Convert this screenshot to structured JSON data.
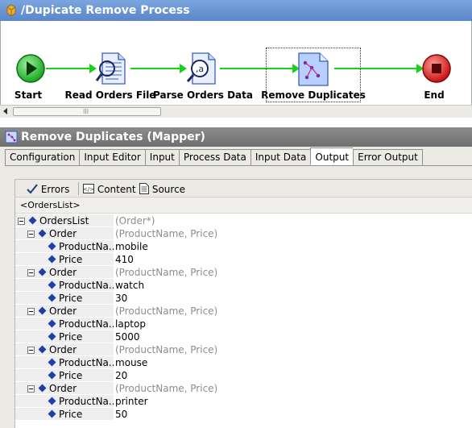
{
  "process": {
    "title": "/Dupicate Remove Process",
    "nodes": [
      {
        "label": "Start"
      },
      {
        "label": "Read Orders File"
      },
      {
        "label": "Parse Orders Data"
      },
      {
        "label": "Remove Duplicates"
      },
      {
        "label": "End"
      }
    ],
    "scroll_grip": "III"
  },
  "mapper": {
    "title": "Remove Duplicates (Mapper)",
    "tabs": [
      "Configuration",
      "Input Editor",
      "Input",
      "Process Data",
      "Input Data",
      "Output",
      "Error Output"
    ],
    "active_tab": "Output",
    "toolbar": {
      "errors": "Errors",
      "content": "Content",
      "source": "Source"
    },
    "root_label": "<OrdersList>",
    "tree": [
      {
        "name": "OrdersList",
        "value": "(Order*)",
        "type": true,
        "level": 0,
        "expander": true
      },
      {
        "name": "Order",
        "value": "(ProductName, Price)",
        "type": true,
        "level": 1,
        "expander": true
      },
      {
        "name": "ProductNa...",
        "value": "mobile",
        "type": false,
        "level": 2,
        "expander": false
      },
      {
        "name": "Price",
        "value": "410",
        "type": false,
        "level": 2,
        "expander": false
      },
      {
        "name": "Order",
        "value": "(ProductName, Price)",
        "type": true,
        "level": 1,
        "expander": true
      },
      {
        "name": "ProductNa...",
        "value": "watch",
        "type": false,
        "level": 2,
        "expander": false
      },
      {
        "name": "Price",
        "value": "30",
        "type": false,
        "level": 2,
        "expander": false
      },
      {
        "name": "Order",
        "value": "(ProductName, Price)",
        "type": true,
        "level": 1,
        "expander": true
      },
      {
        "name": "ProductNa...",
        "value": "laptop",
        "type": false,
        "level": 2,
        "expander": false
      },
      {
        "name": "Price",
        "value": "5000",
        "type": false,
        "level": 2,
        "expander": false
      },
      {
        "name": "Order",
        "value": "(ProductName, Price)",
        "type": true,
        "level": 1,
        "expander": true
      },
      {
        "name": "ProductNa...",
        "value": "mouse",
        "type": false,
        "level": 2,
        "expander": false
      },
      {
        "name": "Price",
        "value": "20",
        "type": false,
        "level": 2,
        "expander": false
      },
      {
        "name": "Order",
        "value": "(ProductName, Price)",
        "type": true,
        "level": 1,
        "expander": true
      },
      {
        "name": "ProductNa...",
        "value": "printer",
        "type": false,
        "level": 2,
        "expander": false
      },
      {
        "name": "Price",
        "value": "50",
        "type": false,
        "level": 2,
        "expander": false
      }
    ]
  },
  "colors": {
    "connector": "#18d21a",
    "start_node": "#22c22a",
    "end_node": "#e02020",
    "diamond": "#1f3fa8"
  }
}
